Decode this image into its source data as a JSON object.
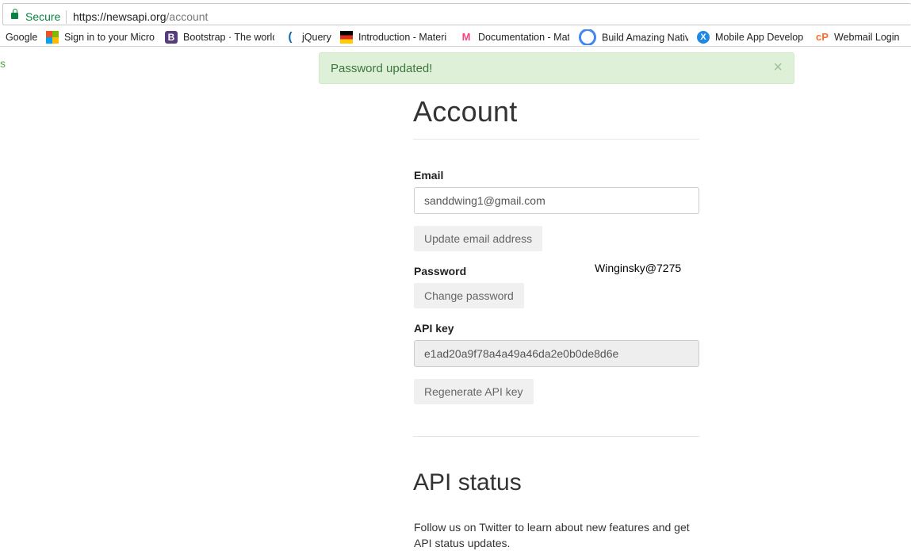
{
  "browser": {
    "secure_label": "Secure",
    "url_host": "https://newsapi.org",
    "url_path": "/account",
    "bookmarks": [
      {
        "label": "Google",
        "icon": "google-icon"
      },
      {
        "label": "Sign in to your Micro",
        "icon": "microsoft-icon"
      },
      {
        "label": "Bootstrap · The world",
        "icon": "bootstrap-icon"
      },
      {
        "label": "jQuery",
        "icon": "jquery-icon"
      },
      {
        "label": "Introduction - Materi",
        "icon": "materialize-icon"
      },
      {
        "label": "Documentation - Mat",
        "icon": "material-icon"
      },
      {
        "label": "Build Amazing Native",
        "icon": "ionic-icon"
      },
      {
        "label": "Mobile App Develop",
        "icon": "xamarin-icon"
      },
      {
        "label": "Webmail Login",
        "icon": "cpanel-icon"
      }
    ]
  },
  "left_fragment": "s",
  "alert": {
    "message": "Password updated!",
    "close": "×"
  },
  "account": {
    "title": "Account",
    "email_label": "Email",
    "email_value": "sanddwing1@gmail.com",
    "update_email_button": "Update email address",
    "password_label": "Password",
    "password_note": "Winginsky@7275",
    "change_password_button": "Change password",
    "api_key_label": "API key",
    "api_key_value": "e1ad20a9f78a4a49a46da2e0b0de8d6e",
    "regenerate_button": "Regenerate API key"
  },
  "api_status": {
    "title": "API status",
    "text": "Follow us on Twitter to learn about new features and get API status updates."
  },
  "colors": {
    "alert_bg": "#dff0d8",
    "alert_text": "#3c763d",
    "secure_green": "#0b8043"
  }
}
